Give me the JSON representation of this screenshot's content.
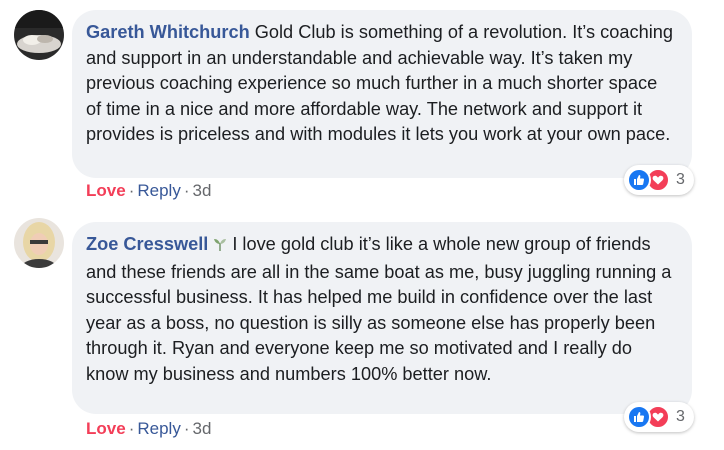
{
  "comments": [
    {
      "author": "Gareth Whitchurch",
      "text": " Gold Club is something of a revolution. It’s coaching and support in an understandable and achievable way. It’s taken my previous coaching experience so much further in a much shorter space of time in a nice and more affordable way. The network and support it provides is priceless and with modules it lets you work at your own pace.",
      "reaction_count": "3",
      "reactions": [
        "like-icon",
        "love-icon"
      ],
      "actions": {
        "love": "Love",
        "reply": "Reply",
        "age": "3d",
        "separator": "·"
      }
    },
    {
      "author": "Zoe Cresswell",
      "badge_icon": "plant-icon",
      "text": "I love gold club it’s like a whole new group of friends and these friends are all in the same boat as me, busy juggling running a successful business. It has helped me build in confidence over the last year as a boss, no question is silly as someone else has properly been through it. Ryan and everyone keep me so motivated and I really do know my business and numbers 100% better now.",
      "reaction_count": "3",
      "reactions": [
        "like-icon",
        "love-icon"
      ],
      "actions": {
        "love": "Love",
        "reply": "Reply",
        "age": "3d",
        "separator": "·"
      }
    }
  ],
  "colors": {
    "author": "#385898",
    "bubble": "#f0f2f5",
    "love": "#f33e58",
    "like": "#1877f2",
    "meta": "#65676b"
  }
}
